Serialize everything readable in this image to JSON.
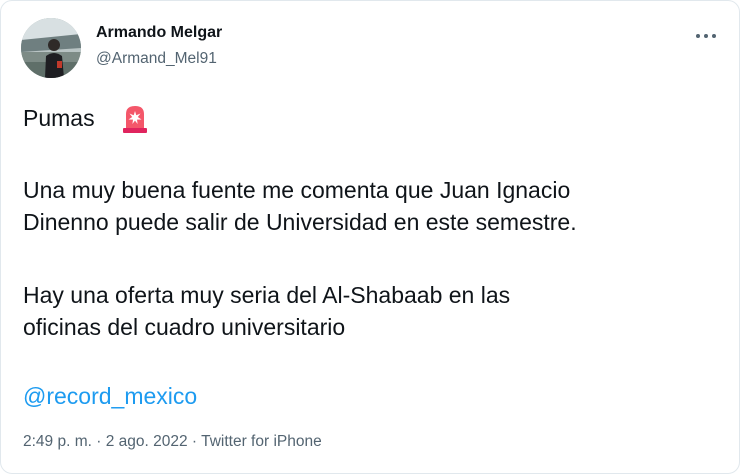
{
  "user": {
    "display_name": "Armando Melgar",
    "handle": "@Armand_Mel91"
  },
  "tweet": {
    "line1": "Pumas",
    "emoji_icon": "siren-icon",
    "line2": "Una muy buena fuente me comenta que Juan Ignacio",
    "line3": "Dinenno puede salir de Universidad en este semestre.",
    "line4": "Hay una oferta muy seria del Al-Shabaab en las",
    "line5": "oficinas del cuadro universitario",
    "mention": "@record_mexico"
  },
  "meta": {
    "time": "2:49 p. m.",
    "separator": " · ",
    "date": "2 ago. 2022",
    "source": "Twitter for iPhone"
  },
  "colors": {
    "text": "#0f1419",
    "secondary": "#536471",
    "link": "#1d9bf0",
    "siren": "#e0245e"
  }
}
